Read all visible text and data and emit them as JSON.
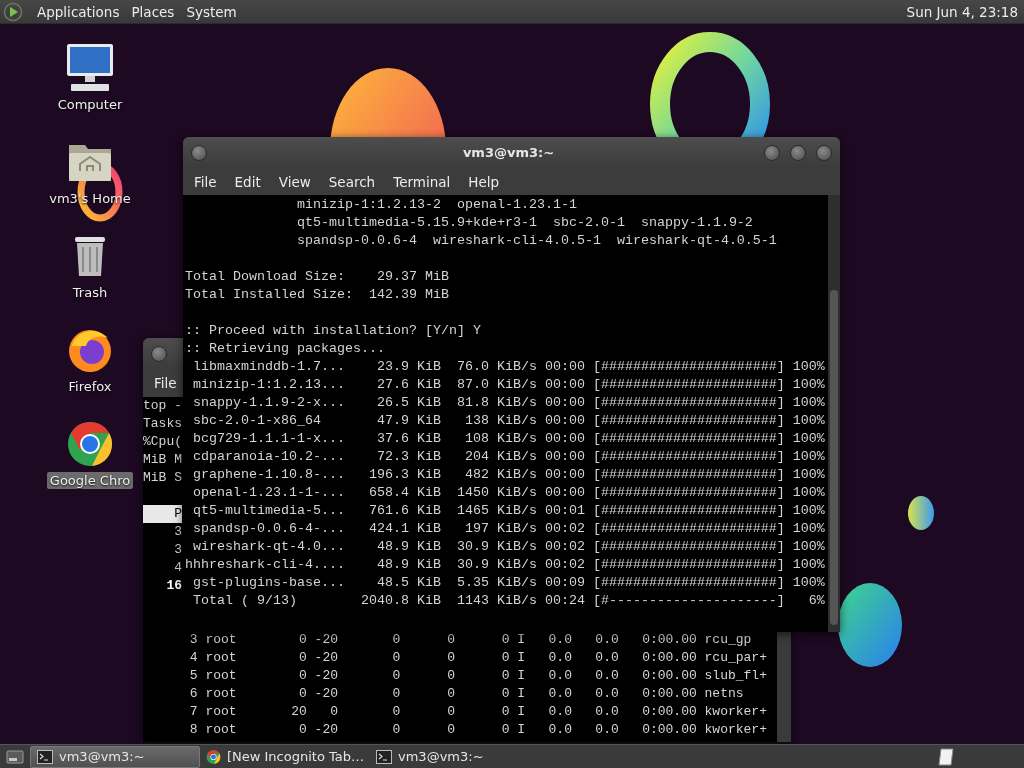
{
  "top_panel": {
    "menus": [
      "Applications",
      "Places",
      "System"
    ],
    "clock": "Sun Jun  4, 23:18"
  },
  "desktop_icons": [
    {
      "kind": "computer",
      "label": "Computer",
      "selected": false
    },
    {
      "kind": "home",
      "label": "vm3's Home",
      "selected": false
    },
    {
      "kind": "trash",
      "label": "Trash",
      "selected": false
    },
    {
      "kind": "firefox",
      "label": "Firefox",
      "selected": false
    },
    {
      "kind": "chrome",
      "label": "Google Chro",
      "selected": true
    }
  ],
  "back_terminal": {
    "menu": [
      "File"
    ],
    "top_fragments": [
      "top -",
      "Tasks",
      "%Cpu(",
      "MiB M",
      "MiB S"
    ],
    "header_fragment": "P",
    "row_fragments": [
      {
        "text": "3",
        "bold": false
      },
      {
        "text": "3",
        "bold": false
      },
      {
        "text": "4",
        "bold": false
      },
      {
        "text": "16",
        "bold": true
      }
    ],
    "processes": [
      {
        "pid": "3",
        "user": "root",
        "pr": "0",
        "ni": "-20",
        "virt": "0",
        "res": "0",
        "shr": "0",
        "s": "I",
        "cpu": "0.0",
        "mem": "0.0",
        "time": "0:00.00",
        "command": "rcu_gp"
      },
      {
        "pid": "4",
        "user": "root",
        "pr": "0",
        "ni": "-20",
        "virt": "0",
        "res": "0",
        "shr": "0",
        "s": "I",
        "cpu": "0.0",
        "mem": "0.0",
        "time": "0:00.00",
        "command": "rcu_par+"
      },
      {
        "pid": "5",
        "user": "root",
        "pr": "0",
        "ni": "-20",
        "virt": "0",
        "res": "0",
        "shr": "0",
        "s": "I",
        "cpu": "0.0",
        "mem": "0.0",
        "time": "0:00.00",
        "command": "slub_fl+"
      },
      {
        "pid": "6",
        "user": "root",
        "pr": "0",
        "ni": "-20",
        "virt": "0",
        "res": "0",
        "shr": "0",
        "s": "I",
        "cpu": "0.0",
        "mem": "0.0",
        "time": "0:00.00",
        "command": "netns"
      },
      {
        "pid": "7",
        "user": "root",
        "pr": "20",
        "ni": "0",
        "virt": "0",
        "res": "0",
        "shr": "0",
        "s": "I",
        "cpu": "0.0",
        "mem": "0.0",
        "time": "0:00.00",
        "command": "kworker+"
      },
      {
        "pid": "8",
        "user": "root",
        "pr": "0",
        "ni": "-20",
        "virt": "0",
        "res": "0",
        "shr": "0",
        "s": "I",
        "cpu": "0.0",
        "mem": "0.0",
        "time": "0:00.00",
        "command": "kworker+"
      }
    ]
  },
  "front_terminal": {
    "title": "vm3@vm3:~",
    "menu": [
      "File",
      "Edit",
      "View",
      "Search",
      "Terminal",
      "Help"
    ],
    "blocks": [
      [
        "              minizip-1:1.2.13-2  openal-1.23.1-1",
        "              qt5-multimedia-5.15.9+kde+r3-1  sbc-2.0-1  snappy-1.1.9-2",
        "              spandsp-0.0.6-4  wireshark-cli-4.0.5-1  wireshark-qt-4.0.5-1"
      ],
      [
        "Total Download Size:    29.37 MiB",
        "Total Installed Size:  142.39 MiB"
      ],
      [
        ":: Proceed with installation? [Y/n] Y",
        ":: Retrieving packages...",
        " libmaxminddb-1.7...    23.9 KiB  76.0 KiB/s 00:00 [######################] 100%",
        " minizip-1:1.2.13...    27.6 KiB  87.0 KiB/s 00:00 [######################] 100%",
        " snappy-1.1.9-2-x...    26.5 KiB  81.8 KiB/s 00:00 [######################] 100%",
        " sbc-2.0-1-x86_64       47.9 KiB   138 KiB/s 00:00 [######################] 100%",
        " bcg729-1.1.1-1-x...    37.6 KiB   108 KiB/s 00:00 [######################] 100%",
        " cdparanoia-10.2-...    72.3 KiB   204 KiB/s 00:00 [######################] 100%",
        " graphene-1.10.8-...   196.3 KiB   482 KiB/s 00:00 [######################] 100%",
        " openal-1.23.1-1-...   658.4 KiB  1450 KiB/s 00:00 [######################] 100%",
        " qt5-multimedia-5...   761.6 KiB  1465 KiB/s 00:01 [######################] 100%",
        " spandsp-0.0.6-4-...   424.1 KiB   197 KiB/s 00:02 [######################] 100%",
        " wireshark-qt-4.0...    48.9 KiB  30.9 KiB/s 00:02 [######################] 100%",
        "hhhreshark-cli-4....    48.9 KiB  30.9 KiB/s 00:02 [######################] 100%",
        " gst-plugins-base...    48.5 KiB  5.35 KiB/s 00:09 [######################] 100%",
        " Total ( 9/13)        2040.8 KiB  1143 KiB/s 00:24 [#---------------------]   6%"
      ]
    ]
  },
  "taskbar": {
    "items": [
      {
        "kind": "terminal",
        "label": "vm3@vm3:~",
        "selected": true
      },
      {
        "kind": "chrome",
        "label": "[New Incognito Tab…",
        "selected": false
      },
      {
        "kind": "terminal",
        "label": "vm3@vm3:~",
        "selected": false
      }
    ]
  }
}
